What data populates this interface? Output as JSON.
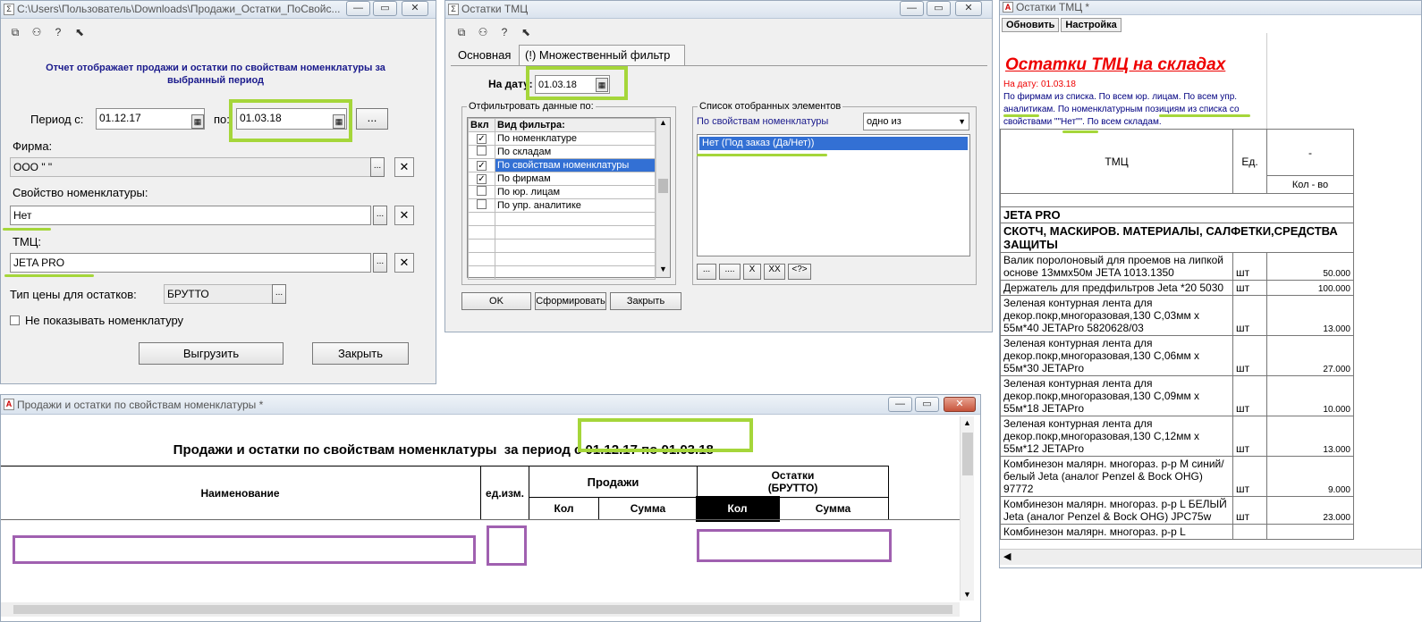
{
  "win1": {
    "title": "C:\\Users\\Пользователь\\Downloads\\Продажи_Остатки_ПоСвойс...",
    "description": "Отчет отображает продажи и остатки по свойствам номенклатуры за выбранный период",
    "period_label": "Период с:",
    "period_from": "01.12.17",
    "to_label": "по:",
    "period_to": "01.03.18",
    "ellipsis": "...",
    "firm_label": "Фирма:",
    "firm_value": "ООО \"    \"",
    "prop_label": "Свойство номенклатуры:",
    "prop_value": "Нет",
    "tmc_label": "ТМЦ:",
    "tmc_value": "JETA PRO",
    "price_label": "Тип цены для остатков:",
    "price_value": "БРУТТО",
    "hide_label": "Не показывать номенклатуру",
    "export_btn": "Выгрузить",
    "close_btn": "Закрыть"
  },
  "win2": {
    "title": "Остатки ТМЦ",
    "tabs": [
      "Основная",
      "(!) Множественный фильтр"
    ],
    "date_label": "На дату:",
    "date_value": "01.03.18",
    "filter_group": "Отфильтровать данные по:",
    "col_on": "Вкл",
    "col_type": "Вид фильтра:",
    "filters": [
      {
        "label": "По номенклатуре",
        "checked": true,
        "selected": false
      },
      {
        "label": "По складам",
        "checked": false,
        "selected": false
      },
      {
        "label": "По свойствам номенклатуры",
        "checked": true,
        "selected": true
      },
      {
        "label": "По фирмам",
        "checked": true,
        "selected": false
      },
      {
        "label": "По юр. лицам",
        "checked": false,
        "selected": false
      },
      {
        "label": "По упр. аналитике",
        "checked": false,
        "selected": false
      }
    ],
    "selected_group": "Список отобранных элементов",
    "selected_by": "По свойствам номенклатуры",
    "mode": "одно из",
    "selected_item": "Нет (Под заказ (Да/Нет))",
    "list_btns": [
      "...",
      "....",
      "X",
      "XX",
      "<?>"
    ],
    "ok_btn": "OK",
    "form_btn": "Сформировать",
    "close_btn": "Закрыть"
  },
  "win3": {
    "title": "Остатки ТМЦ  *",
    "menu": [
      "Обновить",
      "Настройка"
    ],
    "report_title": "Остатки ТМЦ на складах",
    "date_line": "На дату: 01.03.18",
    "filter_line1": "По фирмам из списка. По всем юр. лицам. По всем упр.",
    "filter_line2": "аналитикам. По номенклатурным позициям из списка со",
    "filter_line3": "свойствами \"\"Нет\"\". По всем складам.",
    "col_tmc": "ТМЦ",
    "col_unit": "Ед.",
    "col_dash": "-",
    "col_qty": "Кол - во",
    "group1": "JETA PRO",
    "group2": "СКОТЧ, МАСКИРОВ. МАТЕРИАЛЫ, САЛФЕТКИ,СРЕДСТВА ЗАЩИТЫ",
    "rows": [
      {
        "name": "Валик поролоновый для проемов на липкой основе 13ммх50м JETA 1013.1350",
        "unit": "шт",
        "qty": "50.000"
      },
      {
        "name": "Держатель для предфильтров Jeta *20 5030",
        "unit": "шт",
        "qty": "100.000"
      },
      {
        "name": "Зеленая контурная лента для декор.покр,многоразовая,130 С,03мм х 55м*40 JETAPro 5820628/03",
        "unit": "шт",
        "qty": "13.000"
      },
      {
        "name": "Зеленая контурная лента для декор.покр,многоразовая,130 С,06мм х 55м*30 JETAPro",
        "unit": "шт",
        "qty": "27.000"
      },
      {
        "name": "Зеленая контурная лента для декор.покр,многоразовая,130 С,09мм х 55м*18 JETAPro",
        "unit": "шт",
        "qty": "10.000"
      },
      {
        "name": "Зеленая контурная лента для декор.покр,многоразовая,130 С,12мм х 55м*12 JETAPro",
        "unit": "шт",
        "qty": "13.000"
      },
      {
        "name": "Комбинезон  малярн. многораз. р-р  M синий/белый Jeta (аналог Penzel & Bock OHG) 97772",
        "unit": "шт",
        "qty": "9.000"
      },
      {
        "name": "Комбинезон  малярн. многораз. р-р L БЕЛЫЙ Jeta (аналог Penzel & Bock OHG) JPC75w",
        "unit": "шт",
        "qty": "23.000"
      },
      {
        "name": "Комбинезон  малярн. многораз. р-р L",
        "unit": "",
        "qty": ""
      }
    ]
  },
  "win4": {
    "title": "Продажи и остатки по свойствам номенклатуры  *",
    "header_prefix": "Продажи и остатки по свойствам номенклатуры  за период ",
    "header_period": "с 01.12.17 по 01.03.18",
    "col_name": "Наименование",
    "col_unit": "ед.изм.",
    "col_sales": "Продажи",
    "col_rest": "Остатки\n(БРУТТО)",
    "col_qty": "Кол",
    "col_sum": "Сумма"
  }
}
